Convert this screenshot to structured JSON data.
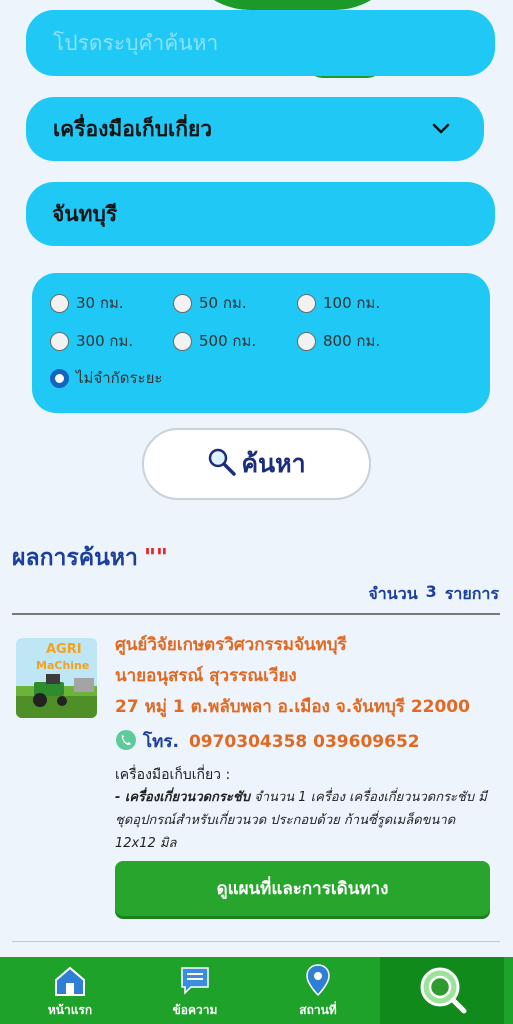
{
  "search": {
    "placeholder": "โปรดระบุคำค้นหา"
  },
  "category": {
    "selected": "เครื่องมือเก็บเกี่ยว"
  },
  "province": {
    "selected": "จันทบุรี"
  },
  "distance": {
    "options": [
      "30 กม.",
      "50 กม.",
      "100 กม.",
      "300 กม.",
      "500 กม.",
      "800 กม.",
      "ไม่จำกัดระยะ"
    ],
    "selected_index": 6
  },
  "search_button": {
    "label": "ค้นหา"
  },
  "results": {
    "title": "ผลการค้นหา",
    "query": "\"\"",
    "count_label": "จำนวน",
    "count": "3",
    "count_unit": "รายการ",
    "items": [
      {
        "thumb_text_1": "AGRI",
        "thumb_text_2": "MaChine",
        "org": "ศูนย์วิจัยเกษตรวิศวกรรมจันทบุรี",
        "person": "นายอนุสรณ์ สุวรรณเวียง",
        "address": "27 หมู่ 1 ต.พลับพลา อ.เมือง จ.จันทบุรี 22000",
        "tel_label": "โทร.",
        "tel": "0970304358 039609652",
        "equip_heading": "เครื่องมือเก็บเกี่ยว :",
        "equip_name": "- เครื่องเกี่ยวนวดกระชับ",
        "equip_desc": "จำนวน 1 เครื่อง เครื่องเกี่ยวนวดกระชับ มีชุดอุปกรณ์สำหรับเกี่ยวนวด ประกอบด้วย ก้านซี่รูดเมล็ดขนาด 12x12 มิล",
        "map_button": "ดูแผนที่และการเดินทาง"
      }
    ]
  },
  "nav": {
    "home": "หน้าแรก",
    "messages": "ข้อความ",
    "places": "สถานที่"
  },
  "colors": {
    "field_bg": "#1fc8f5",
    "accent_orange": "#e06a24",
    "title_blue": "#1c3f9e",
    "nav_green": "#1fa22a"
  }
}
